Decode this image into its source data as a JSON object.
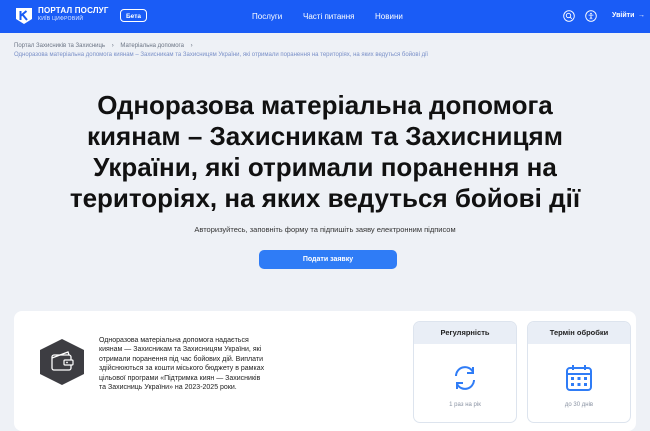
{
  "header": {
    "brand_main": "ПОРТАЛ ПОСЛУГ",
    "brand_sub": "КИЇВ ЦИФРОВИЙ",
    "beta_label": "Бета",
    "nav": [
      "Послуги",
      "Часті питання",
      "Новини"
    ],
    "search_icon": "search-icon",
    "accessibility_icon": "accessibility-icon",
    "login_label": "Увійти",
    "accent_color": "#1a5cf6"
  },
  "breadcrumbs": [
    "Портал Захисників та Захисниць",
    "Матеріальна допомога",
    "Одноразова матеріальна допомога киянам – Захисникам та Захисницям України, які отримали поранення на територіях, на яких ведуться бойові дії"
  ],
  "hero": {
    "title_lines": [
      "Одноразова матеріальна допомога",
      "киянам – Захисникам та Захисницям",
      "України, які отримали поранення на",
      "територіях, на яких ведуться бойові дії"
    ],
    "subtitle": "Авторизуйтесь, заповніть форму та підпишіть заяву електронним підписом",
    "apply_label": "Подати заявку"
  },
  "info": {
    "badge_icon": "wallet-badge-icon",
    "description_lines": [
      "Одноразова матеріальна допомога надається",
      "киянам — Захисникам та Захисницям України, які",
      "отримали поранення під час бойових дій. Виплати",
      "здійснюються за кошти міського бюджету в рамках",
      "цільової програми «Підтримка киян — Захисників",
      "та Захисниць України» на 2023-2025 роки."
    ],
    "regularity": {
      "title": "Регулярність",
      "value": "1 раз на рік",
      "icon": "repeat-icon"
    },
    "processing": {
      "title": "Термін обробки",
      "value": "до 30 днів",
      "icon": "calendar-icon"
    }
  }
}
